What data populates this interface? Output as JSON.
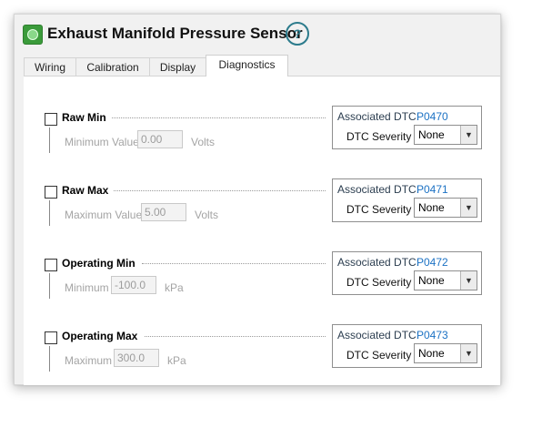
{
  "window": {
    "title": "Exhaust Manifold Pressure Sensor",
    "help_glyph": "?"
  },
  "tabs": [
    {
      "label": "Wiring"
    },
    {
      "label": "Calibration"
    },
    {
      "label": "Display"
    },
    {
      "label": "Diagnostics",
      "active": true
    }
  ],
  "dtc_label": "Associated DTC:",
  "severity_label": "DTC Severity",
  "groups": [
    {
      "title": "Raw Min",
      "checked": false,
      "field_label": "Minimum Value",
      "value": "0.00",
      "unit": "Volts",
      "dtc": "P0470",
      "severity": "None"
    },
    {
      "title": "Raw Max",
      "checked": false,
      "field_label": "Maximum Value",
      "value": "5.00",
      "unit": "Volts",
      "dtc": "P0471",
      "severity": "None"
    },
    {
      "title": "Operating Min",
      "checked": false,
      "field_label": "Minimum",
      "value": "-100.0",
      "unit": "kPa",
      "dtc": "P0472",
      "severity": "None"
    },
    {
      "title": "Operating Max",
      "checked": false,
      "field_label": "Maximum",
      "value": "300.0",
      "unit": "kPa",
      "dtc": "P0473",
      "severity": "None"
    }
  ],
  "colors": {
    "accent": "#2c7b8c",
    "dtc_code": "#1c72c4",
    "title_icon": "#3b9b3b"
  }
}
